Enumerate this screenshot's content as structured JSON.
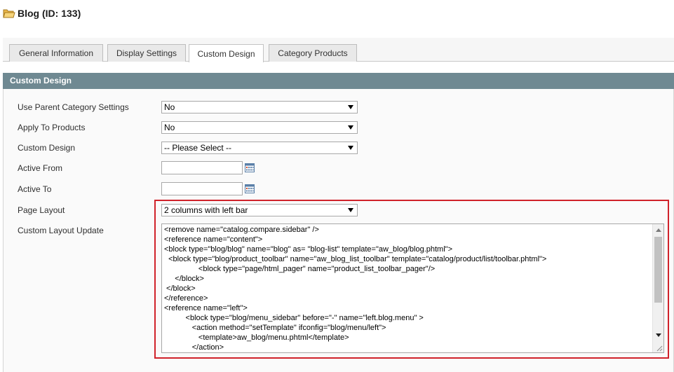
{
  "page": {
    "title": "Blog (ID: 133)",
    "icon": "folder-icon"
  },
  "tabs": [
    {
      "label": "General Information",
      "active": false
    },
    {
      "label": "Display Settings",
      "active": false
    },
    {
      "label": "Custom Design",
      "active": true
    },
    {
      "label": "Category Products",
      "active": false
    }
  ],
  "section": {
    "title": "Custom Design"
  },
  "form": {
    "use_parent": {
      "label": "Use Parent Category Settings",
      "value": "No"
    },
    "apply_to_products": {
      "label": "Apply To Products",
      "value": "No"
    },
    "custom_design": {
      "label": "Custom Design",
      "value": "-- Please Select --"
    },
    "active_from": {
      "label": "Active From",
      "value": ""
    },
    "active_to": {
      "label": "Active To",
      "value": ""
    },
    "page_layout": {
      "label": "Page Layout",
      "value": "2 columns with left bar"
    },
    "custom_layout_update": {
      "label": "Custom Layout Update",
      "value": "<remove name=\"catalog.compare.sidebar\" />\n<reference name=\"content\">\n<block type=\"blog/blog\" name=\"blog\" as= \"blog-list\" template=\"aw_blog/blog.phtml\">\n  <block type=\"blog/product_toolbar\" name=\"aw_blog_list_toolbar\" template=\"catalog/product/list/toolbar.phtml\">\n                <block type=\"page/html_pager\" name=\"product_list_toolbar_pager\"/>\n     </block>\n </block>\n</reference>\n<reference name=\"left\">\n          <block type=\"blog/menu_sidebar\" before=\"-\" name=\"left.blog.menu\" >\n             <action method=\"setTemplate\" ifconfig=\"blog/menu/left\">\n                <template>aw_blog/menu.phtml</template>\n             </action>"
    }
  },
  "colors": {
    "section_header_bg": "#6f8992",
    "highlight_border": "#d0222a"
  }
}
